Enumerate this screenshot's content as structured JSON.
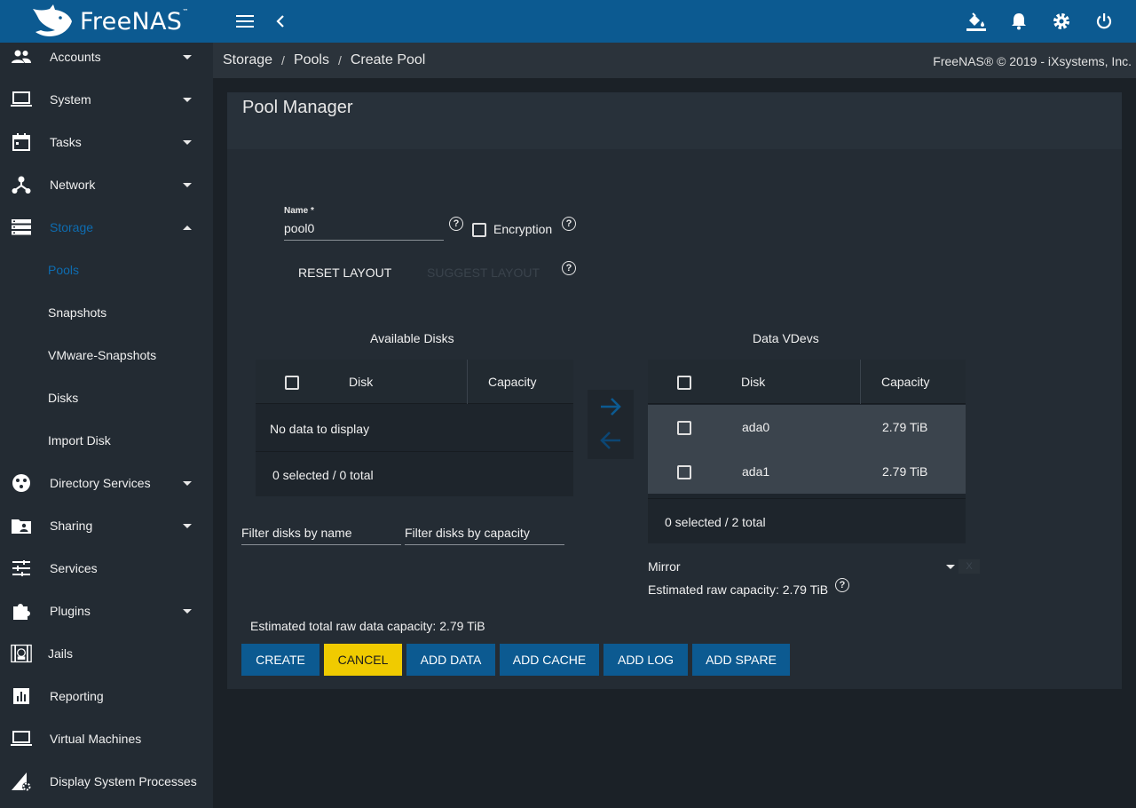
{
  "app": {
    "name": "FreeNAS",
    "trademark": "™"
  },
  "colors": {
    "topbar": "#0c5a91",
    "sidebar": "#232b33",
    "accent": "#0e6cb0",
    "cancel": "#f0cb00"
  },
  "topbar_icons": [
    "menu-icon",
    "back-icon",
    "theme-icon",
    "bell-icon",
    "gear-icon",
    "power-icon"
  ],
  "sidebar": {
    "items": [
      {
        "label": "Accounts",
        "icon": "people-icon"
      },
      {
        "label": "System",
        "icon": "laptop-icon"
      },
      {
        "label": "Tasks",
        "icon": "calendar-icon"
      },
      {
        "label": "Network",
        "icon": "network-icon"
      },
      {
        "label": "Storage",
        "icon": "storage-icon"
      },
      {
        "label": "Directory Services",
        "icon": "directory-icon"
      },
      {
        "label": "Sharing",
        "icon": "folder-shared-icon"
      },
      {
        "label": "Services",
        "icon": "tune-icon"
      },
      {
        "label": "Plugins",
        "icon": "puzzle-icon"
      },
      {
        "label": "Jails",
        "icon": "jail-icon"
      },
      {
        "label": "Reporting",
        "icon": "chart-icon"
      },
      {
        "label": "Virtual Machines",
        "icon": "computer-icon"
      },
      {
        "label": "Display System Processes",
        "icon": "processes-icon"
      }
    ],
    "storage_sub": [
      "Pools",
      "Snapshots",
      "VMware-Snapshots",
      "Disks",
      "Import Disk"
    ]
  },
  "breadcrumb": [
    "Storage",
    "Pools",
    "Create Pool"
  ],
  "copyright": "FreeNAS® © 2019 - iXsystems, Inc.",
  "pool_manager": {
    "title": "Pool Manager",
    "name_label": "Name *",
    "name_value": "pool0",
    "encryption_label": "Encryption",
    "reset_layout": "RESET LAYOUT",
    "suggest_layout": "SUGGEST LAYOUT",
    "available": {
      "title": "Available Disks",
      "col_disk": "Disk",
      "col_capacity": "Capacity",
      "empty": "No data to display",
      "footer": "0 selected / 0 total"
    },
    "vdevs": {
      "title": "Data VDevs",
      "col_disk": "Disk",
      "col_capacity": "Capacity",
      "rows": [
        {
          "disk": "ada0",
          "capacity": "2.79 TiB"
        },
        {
          "disk": "ada1",
          "capacity": "2.79 TiB"
        }
      ],
      "footer": "0 selected / 2 total",
      "layout": "Mirror",
      "remove": "X",
      "estimated": "Estimated raw capacity: 2.79 TiB"
    },
    "filter_name": "Filter disks by name",
    "filter_capacity": "Filter disks by capacity",
    "total_capacity": "Estimated total raw data capacity: 2.79 TiB",
    "buttons": {
      "create": "CREATE",
      "cancel": "CANCEL",
      "add_data": "ADD DATA",
      "add_cache": "ADD CACHE",
      "add_log": "ADD LOG",
      "add_spare": "ADD SPARE"
    }
  }
}
